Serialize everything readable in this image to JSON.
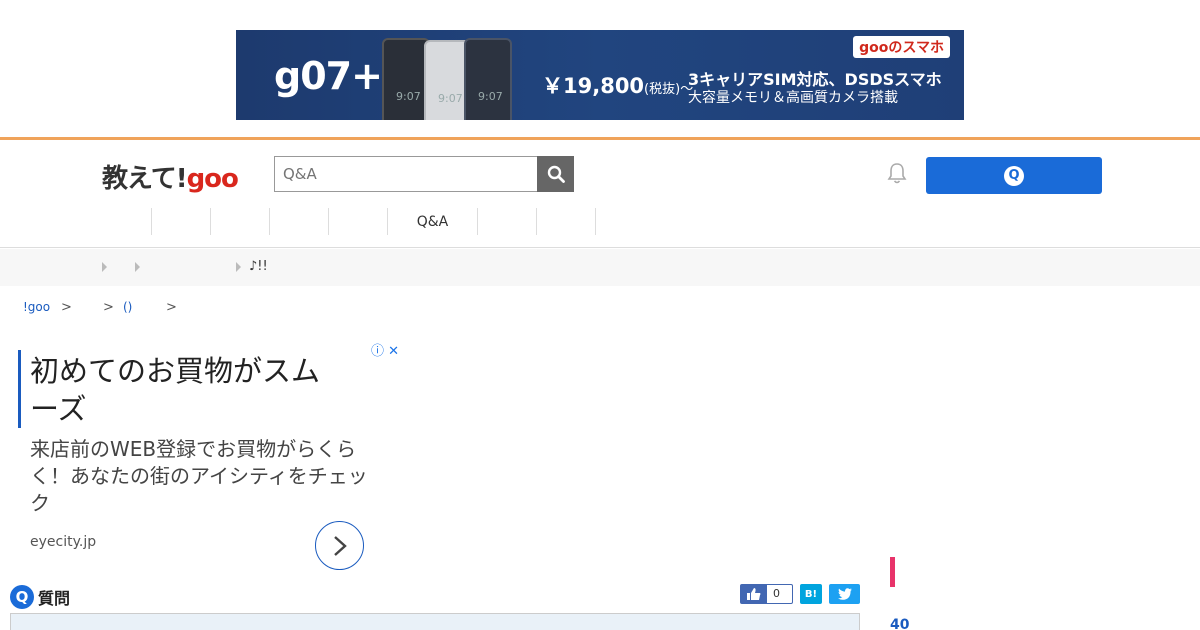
{
  "banner": {
    "model": "g07++",
    "phone_screen_text": "9:07",
    "price": "￥19,800",
    "price_note": "(税抜)～",
    "brand": "gooのスマホ",
    "line1": "3キャリアSIM対応、DSDSスマホ",
    "line2": "大容量メモリ＆高画質カメラ搭載",
    "bg_color": "#21457f"
  },
  "header": {
    "logo_text": "教えて!",
    "logo_goo": "goo",
    "search_placeholder": "Q&A",
    "ask_button_icon": "Q",
    "accent_color": "#1a6bd8",
    "nav": [
      "",
      "",
      "",
      "",
      "",
      "Q&A",
      "",
      ""
    ]
  },
  "subbar": {
    "note": "♪!!"
  },
  "breadcrumb": {
    "root": "!goo",
    "sep": ">",
    "item2": "()"
  },
  "ad": {
    "headline": "初めてのお買物がスムーズ",
    "body": "来店前のWEB登録でお買物がらくらく！あなたの街のアイシティをチェック",
    "domain": "eyecity.jp",
    "info_icon": "ⓘ",
    "close_icon": "✕"
  },
  "question": {
    "icon": "Q",
    "label": "質問",
    "like_count": "0",
    "hatena_label": "B!"
  },
  "sidebar": {
    "rank_number": "40"
  }
}
